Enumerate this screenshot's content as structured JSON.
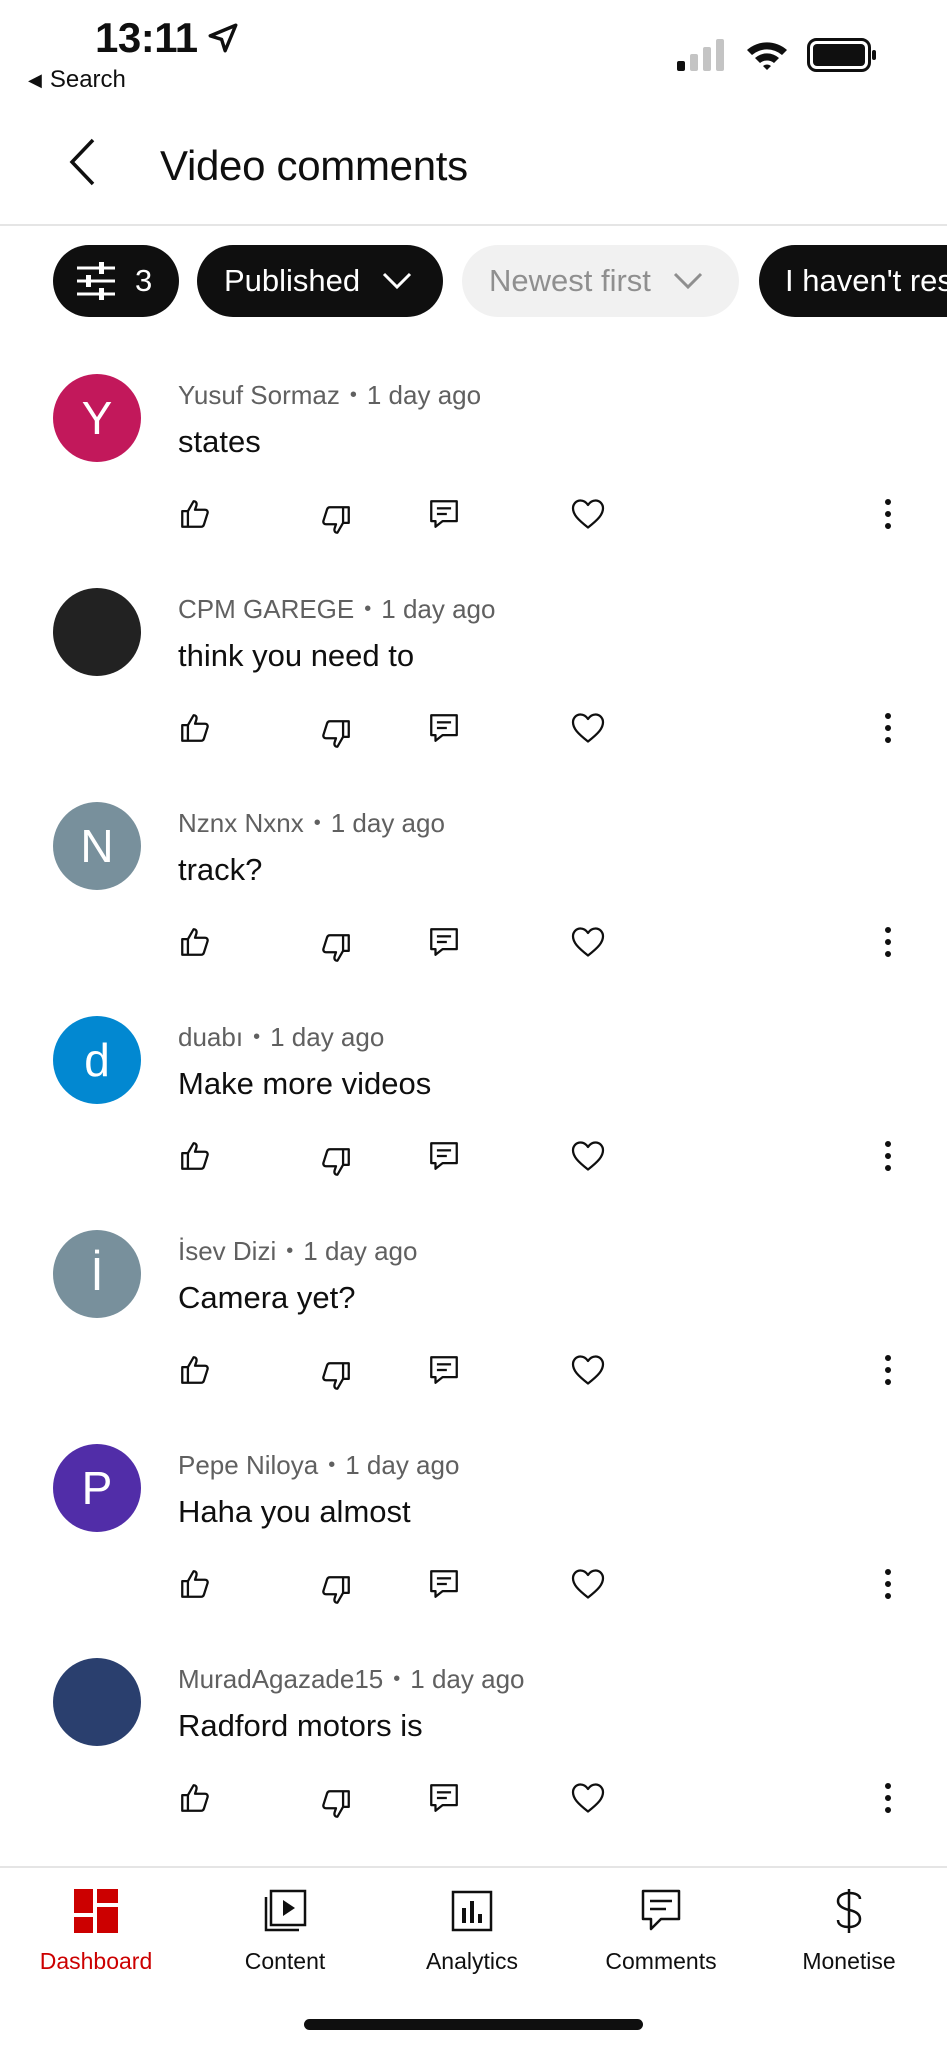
{
  "status_bar": {
    "time": "13:11",
    "back_label": "Search"
  },
  "header": {
    "title": "Video comments"
  },
  "filters": {
    "filter_count": "3",
    "published": "Published",
    "sort": "Newest first",
    "unresponded": "I haven't responded"
  },
  "comments": [
    {
      "author": "Yusuf Sormaz",
      "time": "1 day ago",
      "text": "states",
      "initial": "Y",
      "color": "#c2185b"
    },
    {
      "author": "CPM GAREGE",
      "time": "1 day ago",
      "text": "think you need to",
      "initial": "",
      "color": "#222222"
    },
    {
      "author": "Nznx Nxnx",
      "time": "1 day ago",
      "text": "track?",
      "initial": "N",
      "color": "#78909c"
    },
    {
      "author": "duabı",
      "time": "1 day ago",
      "text": "Make more videos",
      "initial": "d",
      "color": "#0288d1"
    },
    {
      "author": "İsev Dizi",
      "time": "1 day ago",
      "text": "Camera yet?",
      "initial": "İ",
      "color": "#78909c"
    },
    {
      "author": "Pepe Niloya",
      "time": "1 day ago",
      "text": "Haha you almost",
      "initial": "P",
      "color": "#512da8"
    },
    {
      "author": "MuradAgazade15",
      "time": "1 day ago",
      "text": "Radford motors is",
      "initial": "",
      "color": "#2a3f6e"
    }
  ],
  "bottom_nav": {
    "dashboard": "Dashboard",
    "content": "Content",
    "analytics": "Analytics",
    "comments": "Comments",
    "monetise": "Monetise"
  },
  "colors": {
    "accent": "#cc0000",
    "text": "#0f0f0f",
    "meta": "#606060"
  }
}
